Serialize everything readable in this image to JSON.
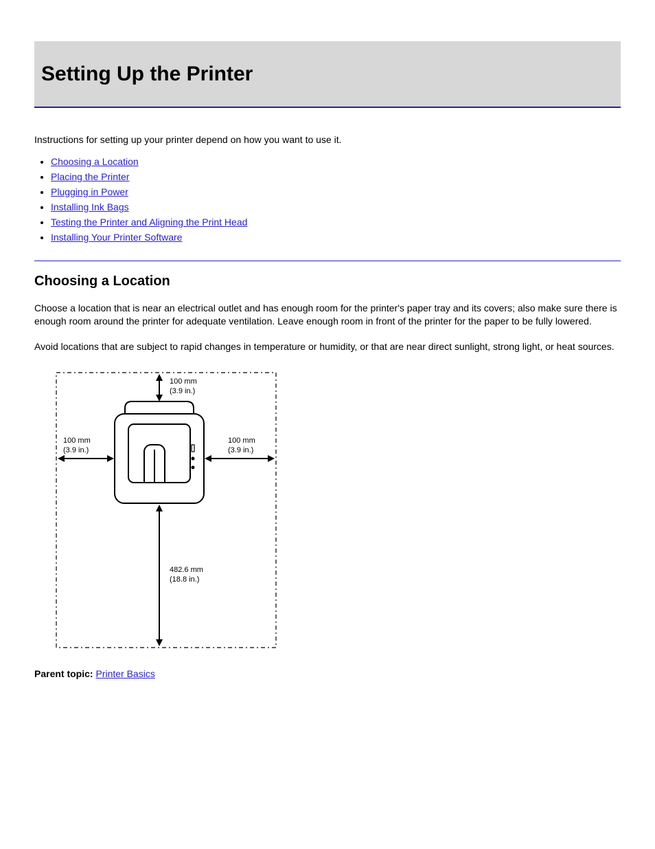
{
  "banner": {
    "title": "Setting Up the Printer"
  },
  "intro": "Instructions for setting up your printer depend on how you want to use it.",
  "toc": [
    "Choosing a Location",
    "Placing the Printer",
    "Plugging in Power",
    "Installing Ink Bags",
    "Testing the Printer and Aligning the Print Head",
    "Installing Your Printer Software"
  ],
  "section": {
    "heading": "Choosing a Location",
    "p1": "Choose a location that is near an electrical outlet and has enough room for the printer's paper tray and its covers; also make sure there is enough room around the printer for adequate ventilation. Leave enough room in front of the printer for the paper to be fully lowered.",
    "p2": "Avoid locations that are subject to rapid changes in temperature or humidity, or that are near direct sunlight, strong light, or heat sources."
  },
  "diagram": {
    "top_mm": "100 mm",
    "top_in": "(3.9 in.)",
    "left_mm": "100 mm",
    "left_in": "(3.9 in.)",
    "right_mm": "100 mm",
    "right_in": "(3.9 in.)",
    "front_mm": "482.6 mm",
    "front_in": "(18.8 in.)"
  },
  "parent_topic": {
    "label": "Parent topic:",
    "link": "Printer Basics"
  }
}
